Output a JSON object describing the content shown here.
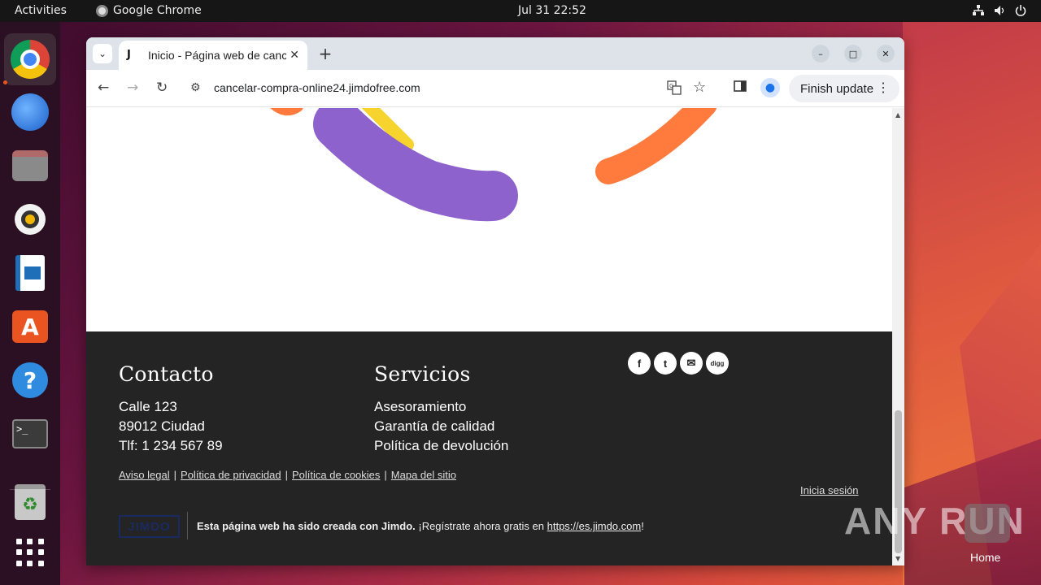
{
  "topbar": {
    "activities": "Activities",
    "app_name": "Google Chrome",
    "clock": "Jul 31  22:52",
    "tray_icons": [
      "network-icon",
      "volume-icon",
      "power-icon"
    ]
  },
  "dock": {
    "items": [
      "chrome",
      "thunderbird",
      "files",
      "rhythmbox",
      "libreoffice-writer",
      "app-center",
      "help",
      "terminal",
      "trash",
      "show-apps"
    ]
  },
  "browser": {
    "tab_title": "Inicio - Página web de cancelar",
    "tab_favicon": "J",
    "url": "cancelar-compra-online24.jimdofree.com",
    "finish_update": "Finish update"
  },
  "page": {
    "contact": {
      "heading": "Contacto",
      "lines": [
        "Calle 123",
        "89012 Ciudad",
        "Tlf: 1 234 567 89"
      ]
    },
    "services": {
      "heading": "Servicios",
      "lines": [
        "Asesoramiento",
        "Garantía de calidad",
        "Política de devolución"
      ]
    },
    "social": [
      "f",
      "t",
      "✉",
      "digg"
    ],
    "links": [
      "Aviso legal",
      "Política de privacidad",
      "Política de cookies",
      "Mapa del sitio"
    ],
    "login": "Inicia sesión",
    "jimdo_logo": "JIMDO",
    "credit_bold": "Esta página web ha sido creada con Jimdo.",
    "credit_text": " ¡Regístrate ahora gratis en ",
    "credit_link": "https://es.jimdo.com",
    "credit_end": "!"
  },
  "desktop": {
    "watermark": "ANY RUN",
    "home_label": "Home"
  },
  "colors": {
    "footer_bg": "#242424",
    "purple_stroke": "#8e62cc",
    "orange_stroke": "#ff7a3d",
    "yellow_stroke": "#f6d32d",
    "ubuntu_orange": "#e95420"
  }
}
